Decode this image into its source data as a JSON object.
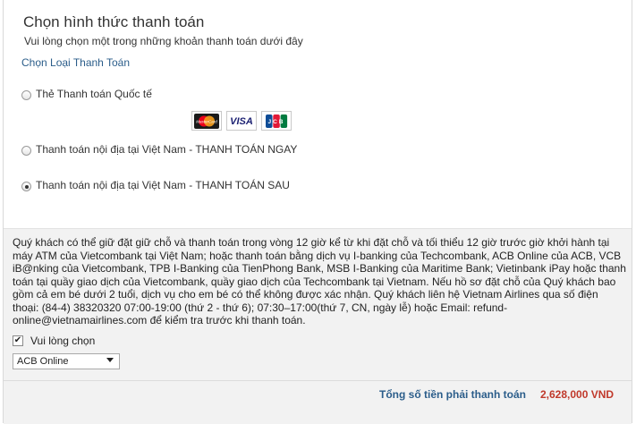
{
  "header": {
    "title": "Chọn hình thức thanh toán",
    "subtitle": "Vui lòng chọn một trong những khoản thanh toán dưới đây",
    "section_label": "Chọn Loại Thanh Toán"
  },
  "payment_options": [
    {
      "label": "Thẻ Thanh toán Quốc tế",
      "selected": false
    },
    {
      "label": "Thanh toán nội địa tại Việt Nam - THANH TOÁN NGAY",
      "selected": false
    },
    {
      "label": "Thanh toán nội địa tại Việt Nam - THANH TOÁN SAU",
      "selected": true
    }
  ],
  "card_logos": {
    "mastercard": "MasterCard",
    "visa": "VISA",
    "jcb": "JCB"
  },
  "notice": {
    "text": "Quý khách có thể giữ đặt giữ chỗ và thanh toán trong vòng 12 giờ kể từ khi đặt chỗ và tối thiểu 12 giờ trước giờ khởi hành tại máy ATM của Vietcombank tại Việt Nam; hoặc thanh toán bằng dịch vụ I-banking của Techcombank, ACB Online của ACB, VCB iB@nking của Vietcombank, TPB I-Banking của TienPhong Bank, MSB I-Banking của Maritime Bank; Vietinbank iPay hoặc thanh toán tại quầy giao dịch của Vietcombank, quầy giao dịch của Techcombank tại Vietnam. Nếu hồ sơ đặt chỗ của Quý khách bao gồm cả em bé dưới 2 tuổi, dịch vụ cho em bé có thể không được xác nhận. Quý khách liên hệ Vietnam Airlines qua số điện thoại: (84-4) 38320320 07:00-19:00 (thứ 2 - thứ 6); 07:30–17:00(thứ 7, CN, ngày lễ) hoặc Email: refund-online@vietnamairlines.com để kiểm tra trước khi thanh toán."
  },
  "confirm": {
    "label": "Vui lòng chọn",
    "checked": true
  },
  "bank_select": {
    "value": "ACB Online"
  },
  "total": {
    "label": "Tổng số tiền phải thanh toán",
    "amount": "2,628,000 VND"
  },
  "colors": {
    "link_blue": "#2b5d8a",
    "amount_red": "#c0392b",
    "bottom_bg": "#f2f2f2"
  }
}
